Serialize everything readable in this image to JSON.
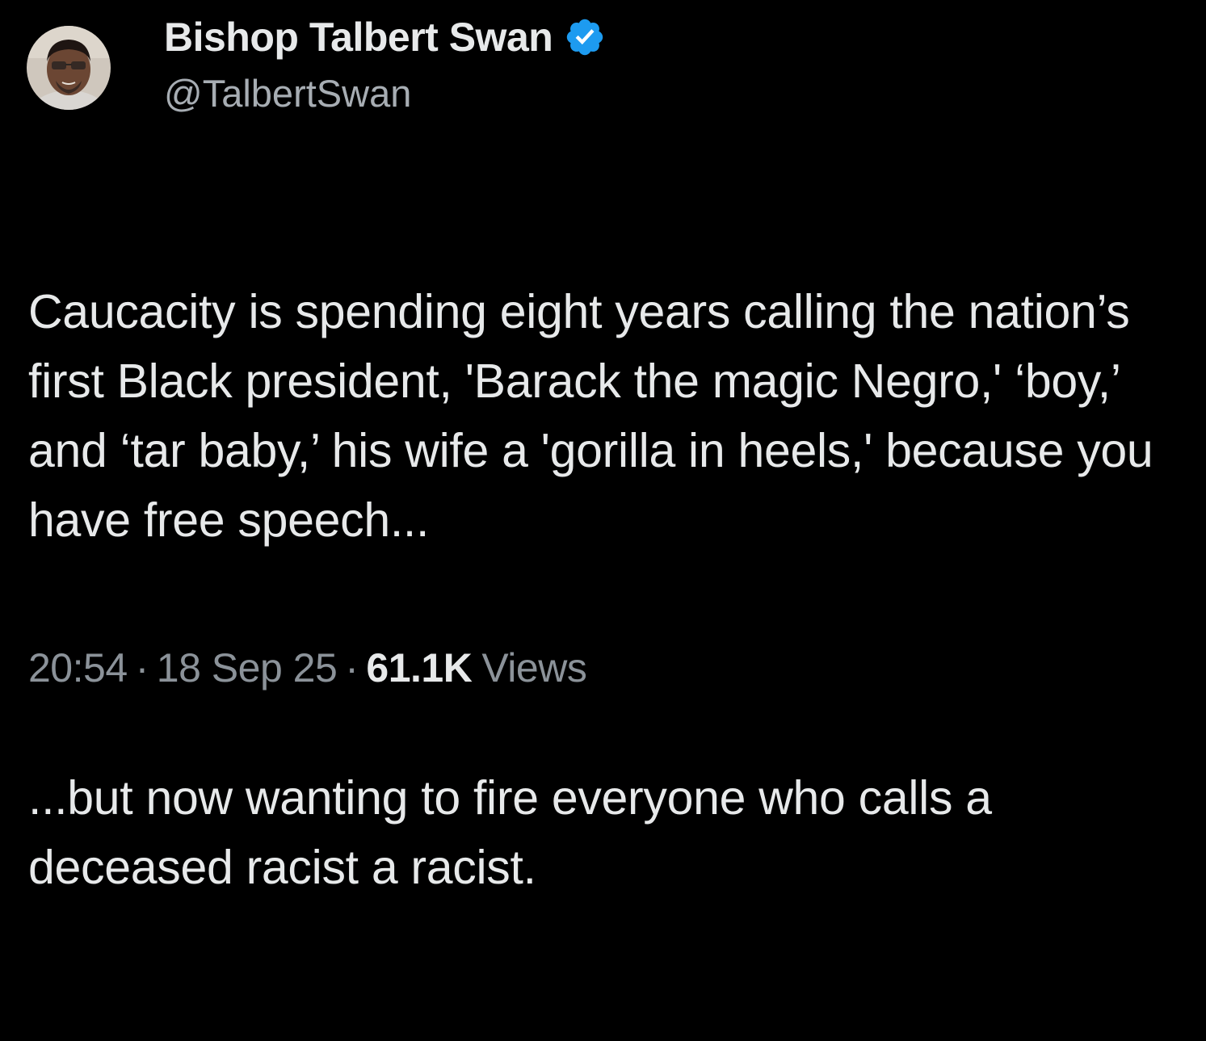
{
  "author": {
    "display_name": "Bishop Talbert Swan",
    "handle": "@TalbertSwan",
    "verified_icon": "verified-badge-icon",
    "verified_color": "#1d9bf0"
  },
  "tweet": {
    "paragraphs": [
      "Caucacity is spending eight years calling the nation’s first Black president, 'Barack the magic Negro,' ‘boy,’ and ‘tar baby,’ his wife a 'gorilla in heels,' because you have free speech...",
      "...but now wanting to fire everyone who calls a deceased racist a racist."
    ]
  },
  "meta": {
    "time": "20:54",
    "separator": "·",
    "date": "18 Sep 25",
    "views_count": "61.1K",
    "views_label": "Views"
  },
  "colors": {
    "background": "#000000",
    "primary_text": "#e7e9ea",
    "secondary_text": "#8b9299"
  }
}
